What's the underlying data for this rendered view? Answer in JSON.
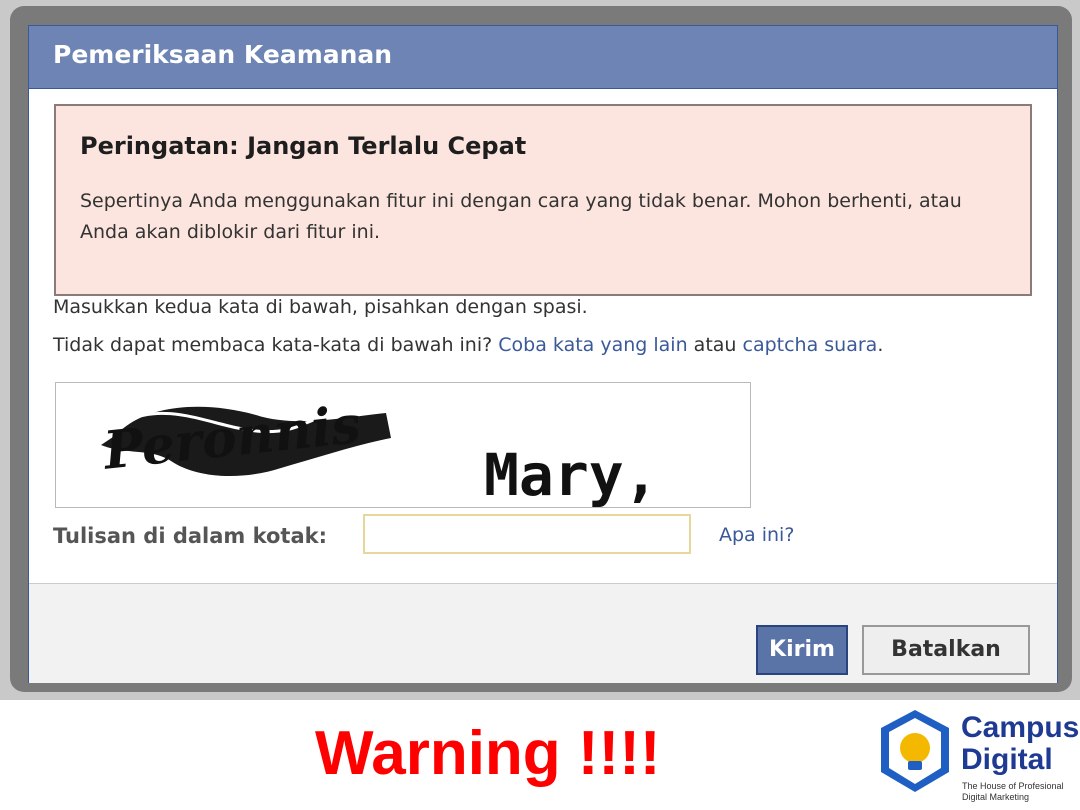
{
  "dialog": {
    "title": "Pemeriksaan Keamanan",
    "warning": {
      "title": "Peringatan: Jangan Terlalu Cepat",
      "text": "Sepertinya Anda menggunakan fitur ini dengan cara yang tidak benar. Mohon berhenti, atau Anda akan diblokir dari fitur ini."
    },
    "instructions": {
      "line1": "Masukkan kedua kata di bawah, pisahkan dengan spasi.",
      "line2_prefix": "Tidak dapat membaca kata-kata di bawah ini?",
      "try_other_link": "Coba kata yang lain",
      "connector": "atau",
      "audio_link": "captcha suara",
      "period": "."
    },
    "captcha": {
      "word1": "Peronnis",
      "word2": "Mary,"
    },
    "input": {
      "label": "Tulisan di dalam kotak:",
      "value": "",
      "help_link": "Apa ini?"
    },
    "buttons": {
      "submit": "Kirim",
      "cancel": "Batalkan"
    }
  },
  "caption": {
    "text": "Warning !!!!",
    "color": "#ff0000"
  },
  "logo": {
    "name_line1": "Campus",
    "name_line2": "Digital",
    "tagline_line1": "The House of Profesional",
    "tagline_line2": "Digital Marketing",
    "icon": "lightbulb-shield-icon",
    "brand_color": "#1f3a93"
  },
  "colors": {
    "header": "#6d84b4",
    "warning_bg": "#fde5df",
    "link": "#3b5998",
    "submit_button": "#5b74a8"
  }
}
